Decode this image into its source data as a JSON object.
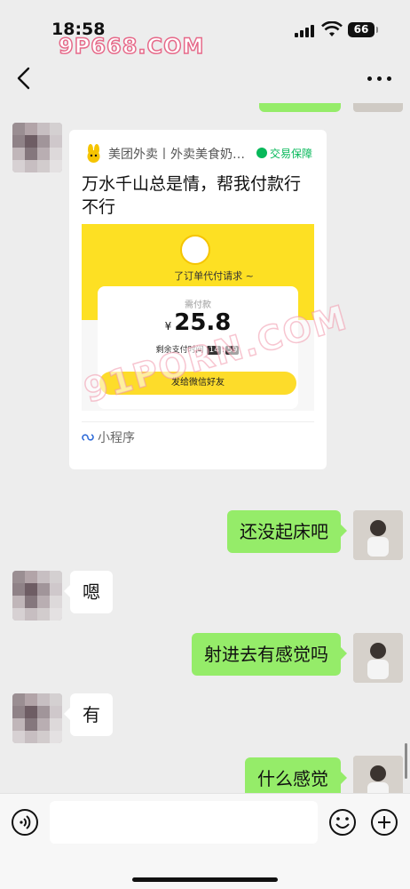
{
  "status_bar": {
    "time": "18:58",
    "battery": "66",
    "watermark": "9P668.COM"
  },
  "chat": {
    "watermark": "91PORN.COM",
    "mini_program_card": {
      "source": "美团外卖丨外卖美食奶…",
      "guarantee": "交易保障",
      "title": "万水千山总是情，帮我付款行不行",
      "subtitle": "了订单代付请求 ~",
      "amount_label": "需付款",
      "currency": "¥",
      "amount": "25.8",
      "countdown_label": "剩余支付时间",
      "countdown_hours": "14",
      "countdown_minutes": "59",
      "button": "发给微信好友",
      "footer": "小程序"
    },
    "messages": [
      {
        "side": "out",
        "text": "还没起床吧"
      },
      {
        "side": "in",
        "text": "嗯"
      },
      {
        "side": "out",
        "text": "射进去有感觉吗"
      },
      {
        "side": "in",
        "text": "有"
      },
      {
        "side": "out",
        "text": "什么感觉"
      }
    ]
  },
  "input_bar": {
    "placeholder": ""
  },
  "colors": {
    "background": "#ededed",
    "outgoing_bubble": "#95ec69",
    "incoming_bubble": "#ffffff",
    "meituan_yellow": "#fde023",
    "guarantee_green": "#07b85a"
  },
  "icons": [
    "signal-icon",
    "wifi-icon",
    "back-arrow-icon",
    "more-icon",
    "meituan-logo-icon",
    "mini-program-icon",
    "voice-icon",
    "emoji-icon",
    "plus-icon"
  ]
}
